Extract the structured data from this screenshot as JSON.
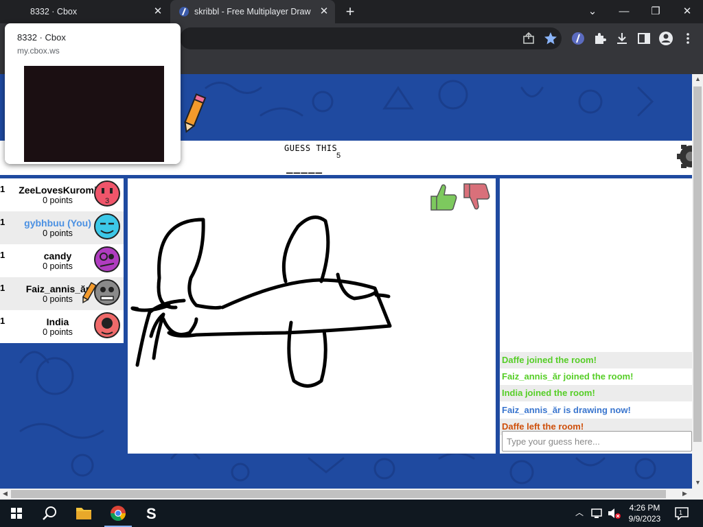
{
  "browser": {
    "tabs": [
      {
        "title": "8332 · Cbox",
        "active": false
      },
      {
        "title": "skribbl - Free Multiplayer Drawing",
        "active": true
      }
    ],
    "preview": {
      "title": "8332 · Cbox",
      "url": "my.cbox.ws"
    }
  },
  "game": {
    "header": {
      "label": "GUESS THIS",
      "word_length": "5",
      "word_blanks": "_____"
    },
    "players": [
      {
        "rank": "1",
        "name": "ZeeLovesKuromi",
        "points": "0 points",
        "is_you": false,
        "avatar_color": "#f0556a",
        "drawing": false
      },
      {
        "rank": "1",
        "name": "gybhbuu (You)",
        "points": "0 points",
        "is_you": true,
        "avatar_color": "#3cc8e8",
        "drawing": false
      },
      {
        "rank": "1",
        "name": "candy",
        "points": "0 points",
        "is_you": false,
        "avatar_color": "#b03cc0",
        "drawing": false
      },
      {
        "rank": "1",
        "name": "Faiz_annis_ăr",
        "points": "0 points",
        "is_you": false,
        "avatar_color": "#8a8a8a",
        "drawing": true
      },
      {
        "rank": "1",
        "name": "India",
        "points": "0 points",
        "is_you": false,
        "avatar_color": "#f06a6a",
        "drawing": false
      }
    ],
    "chat": {
      "messages": [
        {
          "text": "Daffe joined the room!",
          "color": "#56ce27"
        },
        {
          "text": "Faiz_annis_ăr joined the room!",
          "color": "#56ce27"
        },
        {
          "text": "India joined the room!",
          "color": "#56ce27"
        },
        {
          "text": "Faiz_annis_ăr is drawing now!",
          "color": "#3975ce"
        },
        {
          "text": "Daffe left the room!",
          "color": "#ce4f0a"
        }
      ],
      "placeholder": "Type your guess here..."
    }
  },
  "taskbar": {
    "time": "4:26 PM",
    "date": "9/9/2023"
  }
}
